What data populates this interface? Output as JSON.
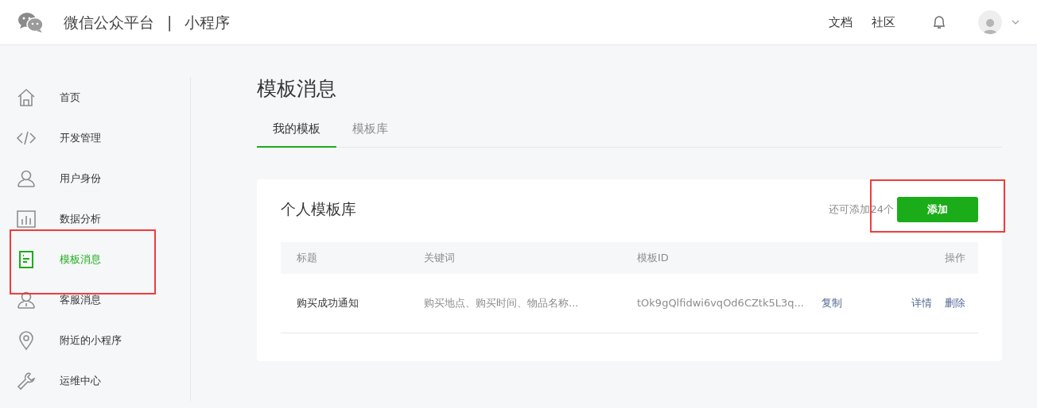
{
  "header": {
    "brand": "微信公众平台",
    "separator": "|",
    "product": "小程序",
    "links": [
      "文档",
      "社区"
    ]
  },
  "sidebar": {
    "items": [
      {
        "label": "首页",
        "selected": false
      },
      {
        "label": "开发管理",
        "selected": false
      },
      {
        "label": "用户身份",
        "selected": false
      },
      {
        "label": "数据分析",
        "selected": false
      },
      {
        "label": "模板消息",
        "selected": true
      },
      {
        "label": "客服消息",
        "selected": false
      },
      {
        "label": "附近的小程序",
        "selected": false
      },
      {
        "label": "运维中心",
        "selected": false
      }
    ]
  },
  "page_title": "模板消息",
  "tabs": [
    {
      "label": "我的模板",
      "selected": true
    },
    {
      "label": "模板库",
      "selected": false
    }
  ],
  "card": {
    "title": "个人模板库",
    "remaining": "还可添加24个",
    "add_button": "添加",
    "table": {
      "columns": [
        "标题",
        "关键词",
        "模板ID",
        "操作"
      ],
      "rows": [
        {
          "title": "购买成功通知",
          "keywords": "购买地点、购买时间、物品名称...",
          "template_id": "tOk9gQlfidwi6vqOd6CZtk5L3q...",
          "copy": "复制",
          "actions": [
            "详情",
            "删除"
          ]
        }
      ]
    }
  }
}
